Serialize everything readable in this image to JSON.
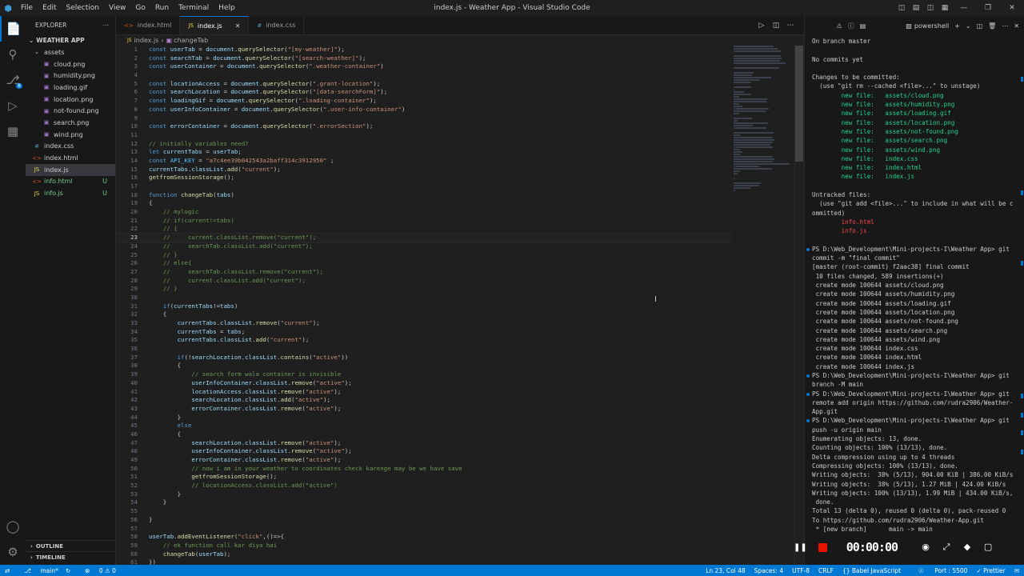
{
  "window": {
    "title": "index.js - Weather App - Visual Studio Code",
    "menu": [
      "File",
      "Edit",
      "Selection",
      "View",
      "Go",
      "Run",
      "Terminal",
      "Help"
    ]
  },
  "activity_bar": {
    "items": [
      "explorer-icon",
      "search-icon",
      "source-control-icon",
      "run-debug-icon",
      "extensions-icon"
    ],
    "bottom": [
      "account-icon",
      "manage-gear-icon"
    ],
    "source_control_badge": "8"
  },
  "explorer": {
    "header": "EXPLORER",
    "project": "WEATHER APP",
    "items": [
      {
        "label": "assets",
        "kind": "folder",
        "indent": 1
      },
      {
        "label": "cloud.png",
        "kind": "image",
        "indent": 2
      },
      {
        "label": "humidity.png",
        "kind": "image",
        "indent": 2
      },
      {
        "label": "loading.gif",
        "kind": "image",
        "indent": 2
      },
      {
        "label": "location.png",
        "kind": "image",
        "indent": 2
      },
      {
        "label": "not-found.png",
        "kind": "image",
        "indent": 2
      },
      {
        "label": "search.png",
        "kind": "image",
        "indent": 2
      },
      {
        "label": "wind.png",
        "kind": "image",
        "indent": 2
      },
      {
        "label": "index.css",
        "kind": "css",
        "indent": 1
      },
      {
        "label": "index.html",
        "kind": "html",
        "indent": 1
      },
      {
        "label": "index.js",
        "kind": "js",
        "indent": 1,
        "selected": true
      },
      {
        "label": "info.html",
        "kind": "html",
        "indent": 1,
        "status": "U",
        "untracked": true
      },
      {
        "label": "info.js",
        "kind": "js",
        "indent": 1,
        "status": "U",
        "untracked": true
      }
    ],
    "outline": "OUTLINE",
    "timeline": "TIMELINE"
  },
  "tabs": [
    {
      "label": "index.html",
      "kind": "html",
      "active": false
    },
    {
      "label": "index.js",
      "kind": "js",
      "active": true
    },
    {
      "label": "index.css",
      "kind": "css",
      "active": false
    }
  ],
  "breadcrumb": [
    "index.js",
    "changeTab"
  ],
  "editor": {
    "current_line": 23,
    "lines": [
      "const userTab = document.querySelector(\"[my-weather]\");",
      "const searchTab = document.querySelector(\"[search-weather]\");",
      "const userContainer = document.querySelector(\".weather-container\")",
      "",
      "const locationAccess = document.querySelector(\".grant-location\");",
      "const searchLocation = document.querySelector(\"[data-searchForm]\");",
      "const loadingGif = document.querySelector(\".loading-container\");",
      "const userInfoContainer = document.querySelector(\".user-info-container\")",
      "",
      "const errorContainer = document.querySelector(\".errorSection\");",
      "",
      "// initially variables need?",
      "let currentTabs = userTab;",
      "const API_KEY = \"a7c4ee39b042543a2baff314c3912950\" ;",
      "currentTabs.classList.add(\"current\");",
      "getfromSessionStorage();",
      "",
      "function changeTab(tabs)",
      "{",
      "    // mylogic",
      "    // if(current!=tabs)",
      "    // {",
      "    //     current.classList.remove(\"current\");",
      "    //     searchTab.classList.add(\"current\");",
      "    // }",
      "    // else{",
      "    //     searchTab.classList.remove(\"current\");",
      "    //     current.classList.add(\"current\");",
      "    // }",
      "",
      "    if(currentTabs!=tabs)",
      "    {",
      "        currentTabs.classList.remove(\"current\");",
      "        currentTabs = tabs;",
      "        currentTabs.classList.add(\"current\");",
      "",
      "        if(!searchLocation.classList.contains(\"active\"))",
      "        {",
      "            // search form wala container is invisible",
      "            userInfoContainer.classList.remove(\"active\");",
      "            locationAccess.classList.remove(\"active\");",
      "            searchLocation.classList.add(\"active\");",
      "            errorContainer.classList.remove(\"active\");",
      "        }",
      "        else",
      "        {",
      "            searchLocation.classList.remove(\"active\");",
      "            userInfoContainer.classList.remove(\"active\");",
      "            errorContainer.classList.remove(\"active\");",
      "            // now i am in your weather to coordinates check karenge may be we have save",
      "            getfromSessionStorage();",
      "            // locationAccess.classList.add(\"active\")",
      "        }",
      "    }",
      "",
      "}",
      "",
      "userTab.addEventListener(\"click\",()=>{",
      "    // ek function call kar diya hai",
      "    changeTab(userTab);",
      "})"
    ]
  },
  "terminal": {
    "shell": "powershell",
    "lines": [
      {
        "t": "On branch master",
        "c": ""
      },
      {
        "t": "",
        "c": ""
      },
      {
        "t": "No commits yet",
        "c": ""
      },
      {
        "t": "",
        "c": ""
      },
      {
        "t": "Changes to be committed:",
        "c": ""
      },
      {
        "t": "  (use \"git rm --cached <file>...\" to unstage)",
        "c": ""
      },
      {
        "t": "        new file:   assets/cloud.png",
        "c": "g"
      },
      {
        "t": "        new file:   assets/humidity.png",
        "c": "g"
      },
      {
        "t": "        new file:   assets/loading.gif",
        "c": "g"
      },
      {
        "t": "        new file:   assets/location.png",
        "c": "g"
      },
      {
        "t": "        new file:   assets/not-found.png",
        "c": "g"
      },
      {
        "t": "        new file:   assets/search.png",
        "c": "g"
      },
      {
        "t": "        new file:   assets/wind.png",
        "c": "g"
      },
      {
        "t": "        new file:   index.css",
        "c": "g"
      },
      {
        "t": "        new file:   index.html",
        "c": "g"
      },
      {
        "t": "        new file:   index.js",
        "c": "g"
      },
      {
        "t": "",
        "c": ""
      },
      {
        "t": "Untracked files:",
        "c": ""
      },
      {
        "t": "  (use \"git add <file>...\" to include in what will be c",
        "c": ""
      },
      {
        "t": "ommitted)",
        "c": ""
      },
      {
        "t": "        info.html",
        "c": "r"
      },
      {
        "t": "        info.js",
        "c": "r"
      },
      {
        "t": "",
        "c": ""
      },
      {
        "t": "PS D:\\Web_Development\\Mini-projects-I\\Weather App> git",
        "c": "",
        "dot": true
      },
      {
        "t": "commit -m \"final commit\"",
        "c": ""
      },
      {
        "t": "[master (root-commit) f2aac38] final commit",
        "c": ""
      },
      {
        "t": " 10 files changed, 589 insertions(+)",
        "c": ""
      },
      {
        "t": " create mode 100644 assets/cloud.png",
        "c": ""
      },
      {
        "t": " create mode 100644 assets/humidity.png",
        "c": ""
      },
      {
        "t": " create mode 100644 assets/loading.gif",
        "c": ""
      },
      {
        "t": " create mode 100644 assets/location.png",
        "c": ""
      },
      {
        "t": " create mode 100644 assets/not-found.png",
        "c": ""
      },
      {
        "t": " create mode 100644 assets/search.png",
        "c": ""
      },
      {
        "t": " create mode 100644 assets/wind.png",
        "c": ""
      },
      {
        "t": " create mode 100644 index.css",
        "c": ""
      },
      {
        "t": " create mode 100644 index.html",
        "c": ""
      },
      {
        "t": " create mode 100644 index.js",
        "c": ""
      },
      {
        "t": "PS D:\\Web_Development\\Mini-projects-I\\Weather App> git",
        "c": "",
        "dot": true
      },
      {
        "t": "branch -M main",
        "c": ""
      },
      {
        "t": "PS D:\\Web_Development\\Mini-projects-I\\Weather App> git",
        "c": "",
        "dot": true
      },
      {
        "t": "remote add origin https://github.com/rudra2906/Weather-",
        "c": ""
      },
      {
        "t": "App.git",
        "c": ""
      },
      {
        "t": "PS D:\\Web_Development\\Mini-projects-I\\Weather App> git",
        "c": "",
        "dot": true
      },
      {
        "t": "push -u origin main",
        "c": ""
      },
      {
        "t": "Enumerating objects: 13, done.",
        "c": ""
      },
      {
        "t": "Counting objects: 100% (13/13), done.",
        "c": ""
      },
      {
        "t": "Delta compression using up to 4 threads",
        "c": ""
      },
      {
        "t": "Compressing objects: 100% (13/13), done.",
        "c": ""
      },
      {
        "t": "Writing objects:  38% (5/13), 904.00 KiB | 386.00 KiB/s",
        "c": ""
      },
      {
        "t": "Writing objects:  38% (5/13), 1.27 MiB | 424.00 KiB/s",
        "c": ""
      },
      {
        "t": "Writing objects: 100% (13/13), 1.99 MiB | 434.00 KiB/s,",
        "c": ""
      },
      {
        "t": " done.",
        "c": ""
      },
      {
        "t": "Total 13 (delta 0), reused 0 (delta 0), pack-reused 0",
        "c": ""
      },
      {
        "t": "To https://github.com/rudra2906/Weather-App.git",
        "c": ""
      },
      {
        "t": " * [new branch]      main -> main",
        "c": ""
      }
    ]
  },
  "recorder": {
    "timer": "00:00:00"
  },
  "status_bar": {
    "branch": "main*",
    "problems": "0 ⚠ 0",
    "position": "Ln 23, Col 48",
    "spaces": "Spaces: 4",
    "encoding": "UTF-8",
    "eol": "CRLF",
    "language": "{} Babel JavaScript",
    "port": "Port : 5500",
    "prettier": "✓ Prettier"
  },
  "colors": {
    "accent": "#0078d4",
    "keyword": "#569cd6",
    "string": "#ce9178",
    "comment": "#6a9955",
    "variable": "#9cdcfe",
    "function": "#dcdcaa"
  }
}
